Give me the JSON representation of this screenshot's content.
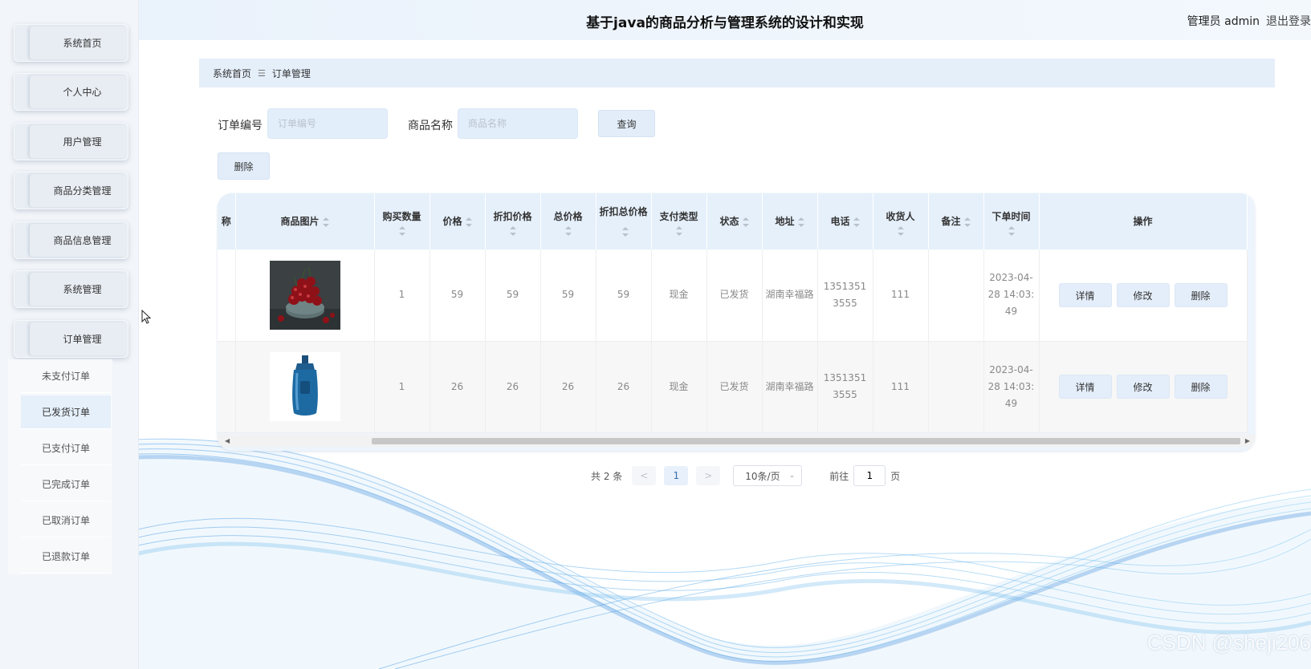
{
  "app_title": "基于java的商品分析与管理系统的设计和实现",
  "user": {
    "role": "管理员 admin",
    "logout": "退出登录"
  },
  "sidebar": {
    "items": [
      {
        "label": "系统首页"
      },
      {
        "label": "个人中心"
      },
      {
        "label": "用户管理"
      },
      {
        "label": "商品分类管理"
      },
      {
        "label": "商品信息管理"
      },
      {
        "label": "系统管理"
      },
      {
        "label": "订单管理"
      }
    ],
    "submenu": [
      {
        "label": "未支付订单"
      },
      {
        "label": "已发货订单"
      },
      {
        "label": "已支付订单"
      },
      {
        "label": "已完成订单"
      },
      {
        "label": "已取消订单"
      },
      {
        "label": "已退款订单"
      }
    ]
  },
  "breadcrumb": {
    "home": "系统首页",
    "current": "订单管理"
  },
  "search": {
    "order_no_label": "订单编号",
    "order_no_placeholder": "订单编号",
    "product_name_label": "商品名称",
    "product_name_placeholder": "商品名称",
    "query_button": "查询",
    "delete_button": "删除"
  },
  "table": {
    "columns": [
      "称",
      "商品图片",
      "购买数量",
      "价格",
      "折扣价格",
      "总价格",
      "折扣总价格",
      "支付类型",
      "状态",
      "地址",
      "电话",
      "收货人",
      "备注",
      "下单时间",
      "操作"
    ],
    "rows": [
      {
        "first": "",
        "image": "cherries-image",
        "qty": "1",
        "price": "59",
        "discount_price": "59",
        "total": "59",
        "discount_total": "59",
        "pay_type": "现金",
        "status": "已发货",
        "address": "湖南幸福路",
        "phone": "13513513555",
        "receiver": "111",
        "remark": "",
        "time": "2023-04-28 14:03:49"
      },
      {
        "first": "",
        "image": "shampoo-bottle-image",
        "qty": "1",
        "price": "26",
        "discount_price": "26",
        "total": "26",
        "discount_total": "26",
        "pay_type": "现金",
        "status": "已发货",
        "address": "湖南幸福路",
        "phone": "13513513555",
        "receiver": "111",
        "remark": "",
        "time": "2023-04-28 14:03:49"
      }
    ],
    "actions": {
      "detail": "详情",
      "edit": "修改",
      "delete": "删除"
    }
  },
  "pagination": {
    "total": "共 2 条",
    "prev": "<",
    "current_page": "1",
    "next": ">",
    "page_size": "10条/页",
    "goto_prefix": "前往",
    "goto_value": "1",
    "goto_suffix": "页"
  },
  "watermark": "CSDN @sheji206",
  "colors": {
    "accent": "#e3eefb",
    "header_bg": "#eaf2fb",
    "sidebar_bg": "#f2f5f9"
  }
}
